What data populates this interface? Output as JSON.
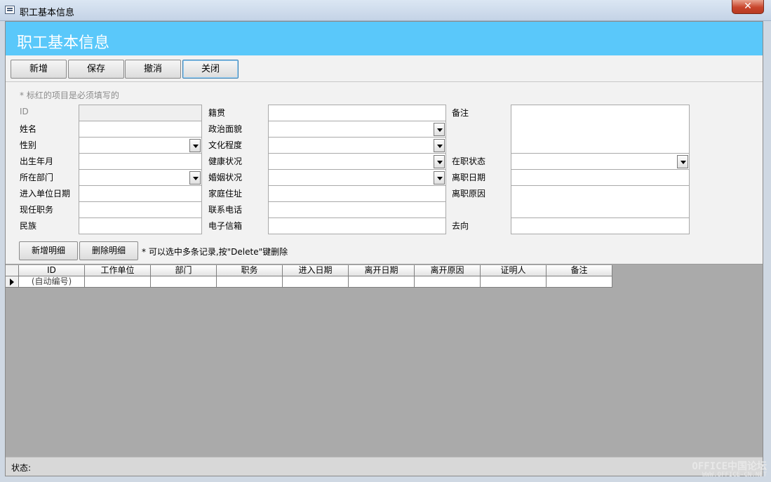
{
  "window": {
    "title": "职工基本信息",
    "close_label": "✕"
  },
  "header": {
    "title": "职工基本信息"
  },
  "toolbar": {
    "add": "新增",
    "save": "保存",
    "undo": "撤消",
    "close": "关闭"
  },
  "form": {
    "note": "* 标红的项目是必须填写的",
    "labels": {
      "id": "ID",
      "name": "姓名",
      "gender": "性别",
      "birth": "出生年月",
      "dept": "所在部门",
      "join_date": "进入单位日期",
      "position": "现任职务",
      "ethnicity": "民族",
      "native": "籍贯",
      "political": "政治面貌",
      "education": "文化程度",
      "health": "健康状况",
      "marital": "婚姻状况",
      "address": "家庭住址",
      "phone": "联系电话",
      "email": "电子信箱",
      "remark": "备注",
      "status": "在职状态",
      "leave_date": "离职日期",
      "leave_reason": "离职原因",
      "destination": "去向"
    },
    "add_detail": "新增明细",
    "delete_detail": "删除明细",
    "hint": "* 可以选中多条记录,按\"Delete\"键删除"
  },
  "grid": {
    "columns": [
      "ID",
      "工作单位",
      "部门",
      "职务",
      "进入日期",
      "离开日期",
      "离开原因",
      "证明人",
      "备注"
    ],
    "new_row": [
      "(自动编号)",
      "",
      "",
      "",
      "",
      "",
      "",
      "",
      ""
    ]
  },
  "statusbar": {
    "label": "状态:"
  },
  "watermark": {
    "line1": "OFFICE中国论坛",
    "line2": "WWW.OFFICE-CN.NET"
  }
}
